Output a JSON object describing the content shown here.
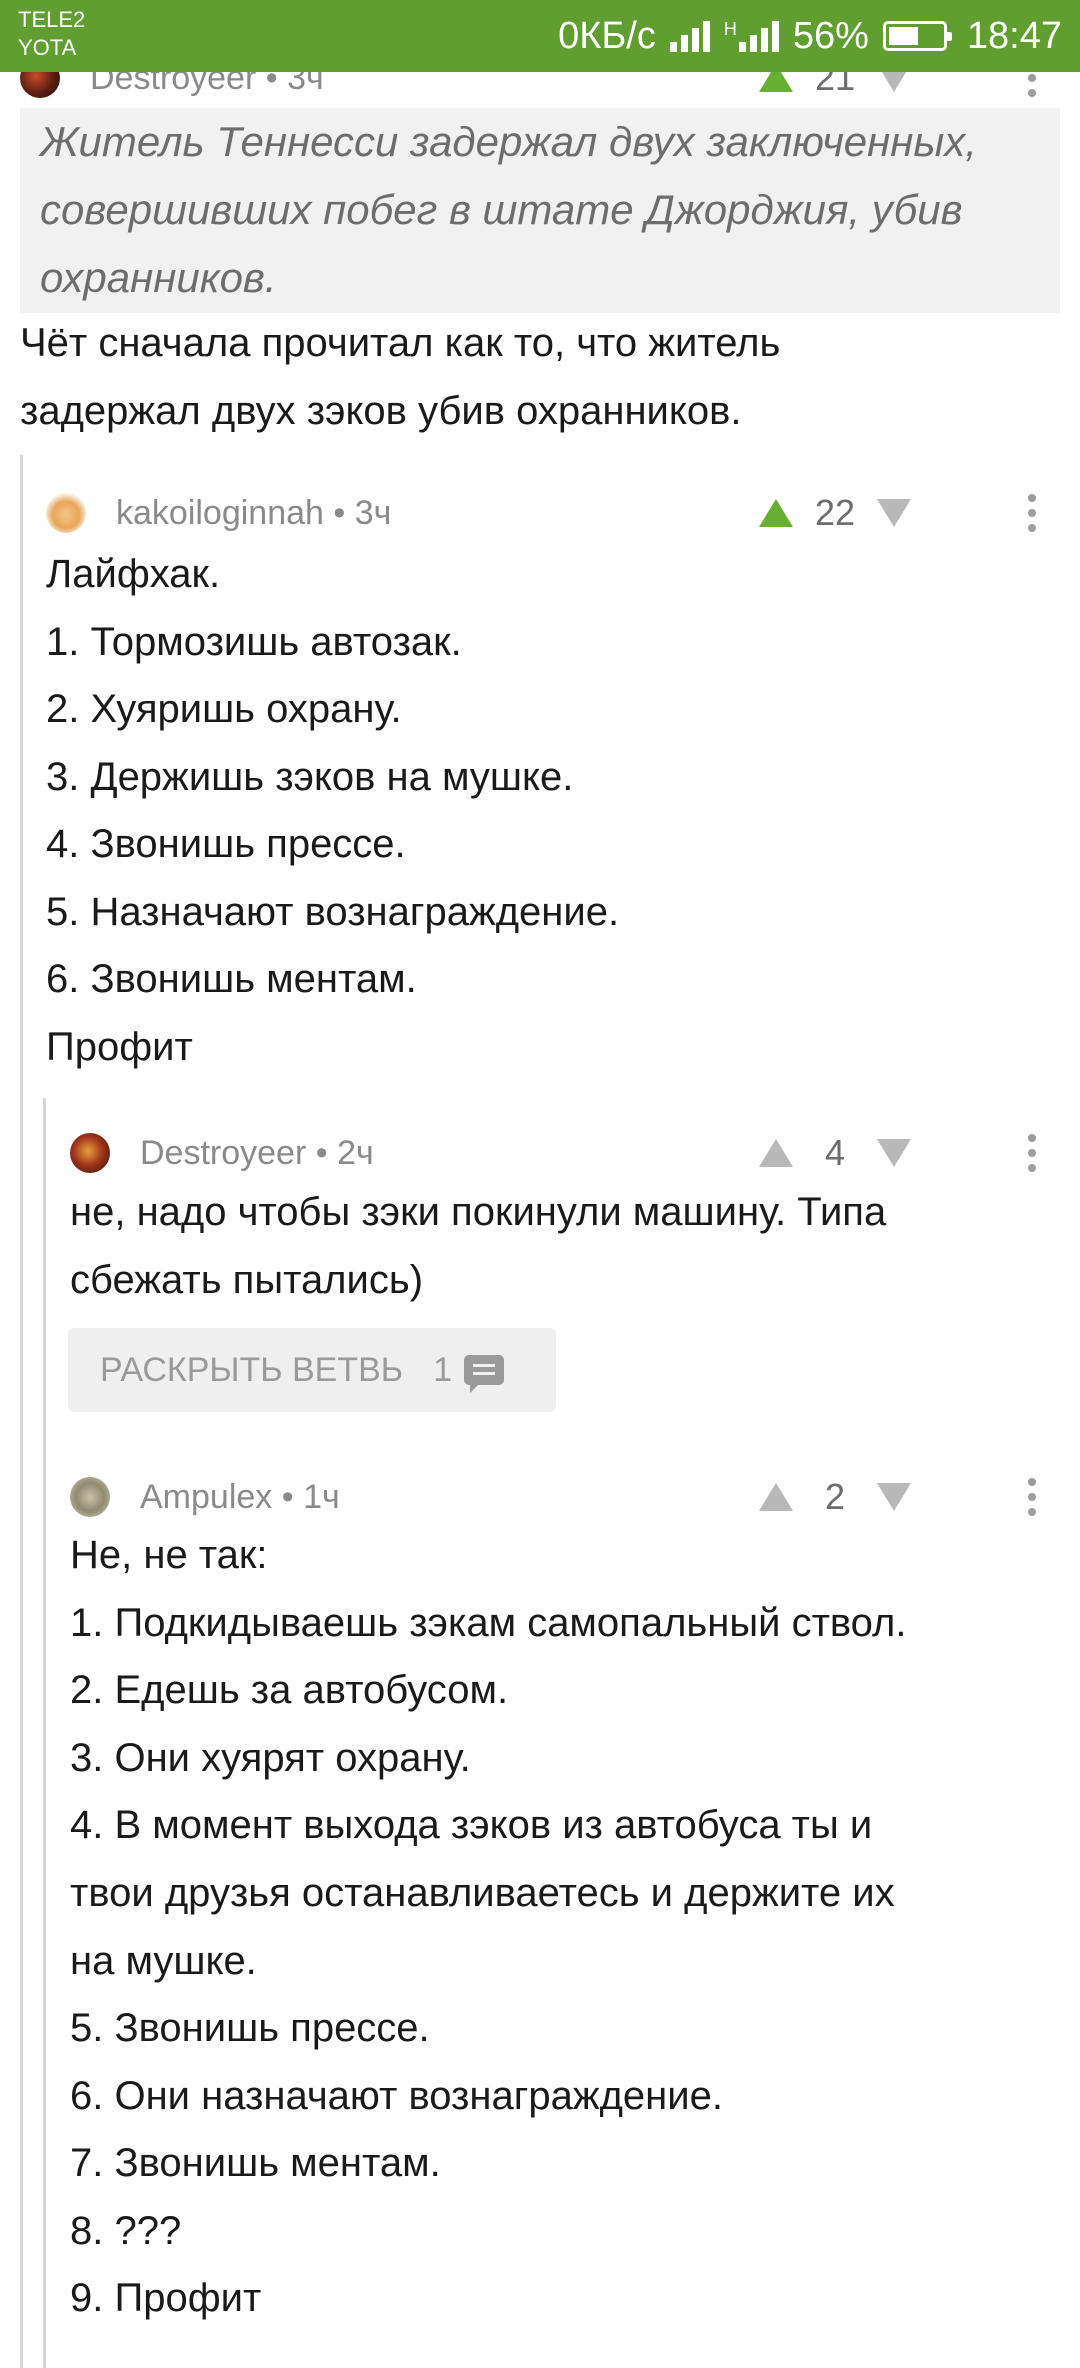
{
  "status_bar": {
    "carrier_1": "TELE2",
    "carrier_2": "YOTA",
    "data_rate": "0КБ/с",
    "network_type": "H",
    "battery_percent": "56%",
    "battery_level": 0.56,
    "time": "18:47"
  },
  "colors": {
    "status_bar": "#5f9e2f",
    "upvote_active": "#68b032",
    "quote_bg": "#f1f1f1"
  },
  "top_comment": {
    "author": "Destroyeer",
    "time": "3ч",
    "score": "21",
    "quote": "Житель Теннесси задержал двух заключенных, совершивших побег в штате Джорджия, убив охранников.",
    "text": "Чёт сначала прочитал как то, что житель\nзадержал двух зэков убив охранников."
  },
  "comments": [
    {
      "author": "kakoiloginnah",
      "time": "3ч",
      "score": "22",
      "upvoted": true,
      "lines": [
        "Лайфхак.",
        "1. Тормозишь автозак.",
        "2. Хуяришь охрану.",
        "3. Держишь зэков на мушке.",
        "4. Звонишь прессе.",
        "5. Назначают вознаграждение.",
        "6. Звонишь ментам.",
        "Профит"
      ]
    },
    {
      "author": "Destroyeer",
      "time": "2ч",
      "score": "4",
      "upvoted": false,
      "lines": [
        "не, надо чтобы зэки покинули машину. Типа",
        "сбежать пытались)"
      ]
    },
    {
      "author": "Ampulex",
      "time": "1ч",
      "score": "2",
      "upvoted": false,
      "lines": [
        "Не, не так:",
        "1. Подкидываешь зэкам самопальный ствол.",
        "2. Едешь за автобусом.",
        "3. Они хуярят охрану.",
        "4. В момент выхода зэков из автобуса ты и",
        "твои друзья останавливаетесь и держите их",
        "на мушке.",
        "5. Звонишь прессе.",
        "6. Они назначают вознаграждение.",
        "7. Звонишь ментам.",
        "8. ???",
        "9. Профит"
      ]
    }
  ],
  "expand_branch": {
    "label": "РАСКРЫТЬ ВЕТВЬ",
    "count": "1"
  },
  "icons": [
    "upvote-icon",
    "downvote-icon",
    "more-options-icon",
    "comment-bubble-icon",
    "signal-icon",
    "battery-icon"
  ]
}
